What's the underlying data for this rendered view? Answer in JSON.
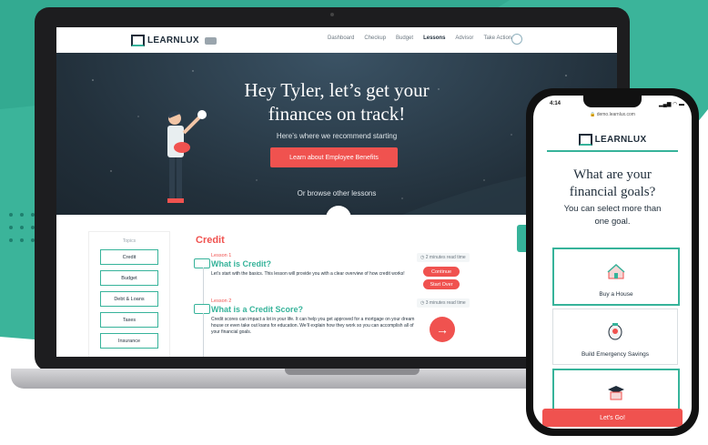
{
  "colors": {
    "teal": "#36b39a",
    "red": "#f0524f",
    "navy": "#1f2d3a",
    "hero_bg": "#22303b"
  },
  "site": {
    "logo_text": "LEARNLUX",
    "nav_links": [
      "Dashboard",
      "Checkup",
      "Budget",
      "Lessons",
      "Advisor",
      "Take Action"
    ],
    "active_nav": "Lessons",
    "hero": {
      "title_line1": "Hey Tyler, let’s get your",
      "title_line2": "finances on track!",
      "subtitle": "Here’s where we recommend starting",
      "cta_label": "Learn about Employee Benefits",
      "browse_text": "Or browse other lessons"
    },
    "topics": {
      "title": "Topics",
      "items": [
        "Credit",
        "Budget",
        "Debt & Loans",
        "Taxes",
        "Insurance"
      ]
    },
    "section_title": "Credit",
    "lessons": [
      {
        "number": "Lesson 1",
        "title": "What is Credit?",
        "description": "Let’s start with the basics. This lesson will provide you with a clear overview of how credit works!",
        "read_time": "2 minutes read time",
        "actions": [
          "Continue",
          "Start Over"
        ]
      },
      {
        "number": "Lesson 2",
        "title": "What is a Credit Score?",
        "description": "Credit scores can impact a lot in your life. It can help you get approved for a mortgage on your dream house or even take out loans for education. We’ll explain how they work so you can accomplish all of your financial goals.",
        "read_time": "3 minutes read time"
      }
    ]
  },
  "phone": {
    "time": "4:14",
    "status_icons": "▂▄▆ ◠ ▬",
    "url": "demo.learnlux.com",
    "logo_text": "LEARNLUX",
    "heading_line1": "What are your",
    "heading_line2": "financial goals?",
    "subheading": "You can select more than one goal.",
    "goals": [
      {
        "label": "Buy a House",
        "selected": true
      },
      {
        "label": "Build Emergency Savings",
        "selected": false
      },
      {
        "label": "",
        "selected": true
      }
    ],
    "cta_label": "Let's Go!"
  }
}
